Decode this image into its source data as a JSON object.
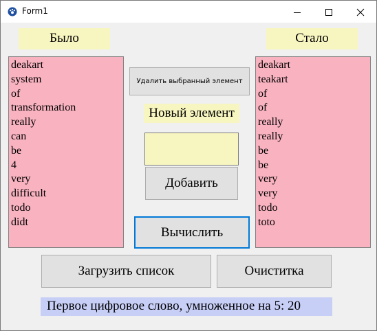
{
  "window": {
    "title": "Form1"
  },
  "labels": {
    "before": "Было",
    "after": "Стало",
    "new_item": "Новый элемент"
  },
  "before_list": [
    "deakart",
    "system",
    "of",
    "transformation",
    "really",
    "can",
    "be",
    "4",
    "very",
    "difficult",
    "todo",
    "didt"
  ],
  "after_list": [
    "deakart",
    "teakart",
    "of",
    "of",
    "really",
    "really",
    "be",
    "be",
    "very",
    "very",
    "todo",
    "toto"
  ],
  "buttons": {
    "delete_selected": "Удалить выбранный элемент",
    "add": "Добавить",
    "compute": "Вычислить",
    "load_list": "Загрузить список",
    "clear": "Очиститка"
  },
  "new_item_input": {
    "value": ""
  },
  "result": {
    "text": "Первое цифровое слово, умноженное на 5: 20"
  },
  "colors": {
    "label_bg": "#f8f6c0",
    "list_bg": "#f9b3c0",
    "result_bg": "#c8cff7",
    "focus_border": "#0078d7"
  }
}
